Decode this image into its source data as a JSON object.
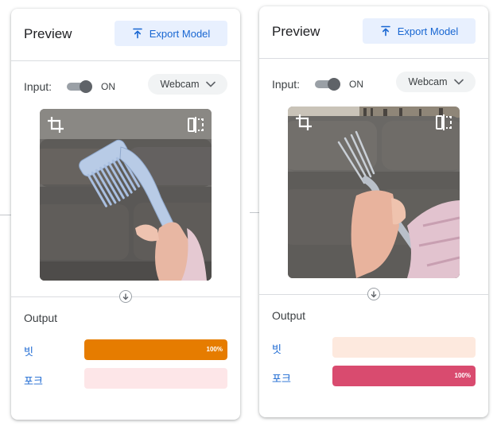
{
  "panels": [
    {
      "header": {
        "title": "Preview",
        "export_label": "Export Model"
      },
      "input": {
        "label": "Input:",
        "toggle_state": "ON",
        "source": "Webcam"
      },
      "scene": "hair-comb",
      "output": {
        "title": "Output",
        "classes": [
          {
            "label": "빗",
            "confidence": 100,
            "confidence_label": "100%",
            "color": "#e67c00",
            "track_color": "#fde7d8"
          },
          {
            "label": "포크",
            "confidence": 0,
            "confidence_label": "",
            "color": "#d64e6b",
            "track_color": "#fde6e8"
          }
        ]
      }
    },
    {
      "header": {
        "title": "Preview",
        "export_label": "Export Model"
      },
      "input": {
        "label": "Input:",
        "toggle_state": "ON",
        "source": "Webcam"
      },
      "scene": "fork",
      "output": {
        "title": "Output",
        "classes": [
          {
            "label": "빗",
            "confidence": 0,
            "confidence_label": "",
            "color": "#e67c00",
            "track_color": "#fde9de"
          },
          {
            "label": "포크",
            "confidence": 100,
            "confidence_label": "100%",
            "color": "#d94b6f",
            "track_color": "#fde6e8"
          }
        ]
      }
    }
  ]
}
